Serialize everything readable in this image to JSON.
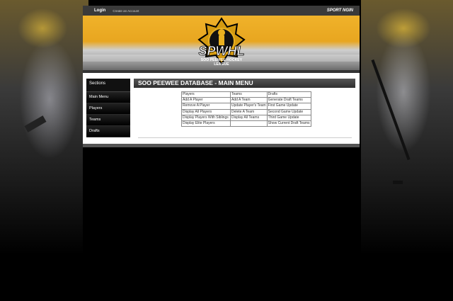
{
  "topbar": {
    "login": "Login",
    "create_account": "Create an Account",
    "brand": "SPORT NGIN"
  },
  "logo": {
    "title": "SPWHL",
    "tagline": "SOO PEEWEE HOCKEY LEAGUE"
  },
  "sidebar": {
    "section_title": "Sections",
    "items": [
      {
        "label": "Main Menu"
      },
      {
        "label": "Players"
      },
      {
        "label": "Teams"
      },
      {
        "label": "Drafts"
      }
    ]
  },
  "main": {
    "heading": "SOO PEEWEE DATABASE - MAIN MENU",
    "table": {
      "headers": [
        "Players",
        "Teams",
        "Drafts"
      ],
      "rows": [
        [
          "Add A Player",
          "Add A Team",
          "Generate Draft Teams"
        ],
        [
          "Remove A Player",
          "Update Player's Team",
          "First Game Update"
        ],
        [
          "Display All Players",
          "Delete A Team",
          "Second Game Update"
        ],
        [
          "Display Players With Siblings",
          "Display All Teams",
          "Third Game Update"
        ],
        [
          "Display Elite Players",
          "",
          "Show Current Draft Teams"
        ]
      ]
    }
  },
  "colors": {
    "banner_gold": "#f0b22a",
    "panel_bg": "#ffffff",
    "header_bg": "#3a3a3a"
  }
}
